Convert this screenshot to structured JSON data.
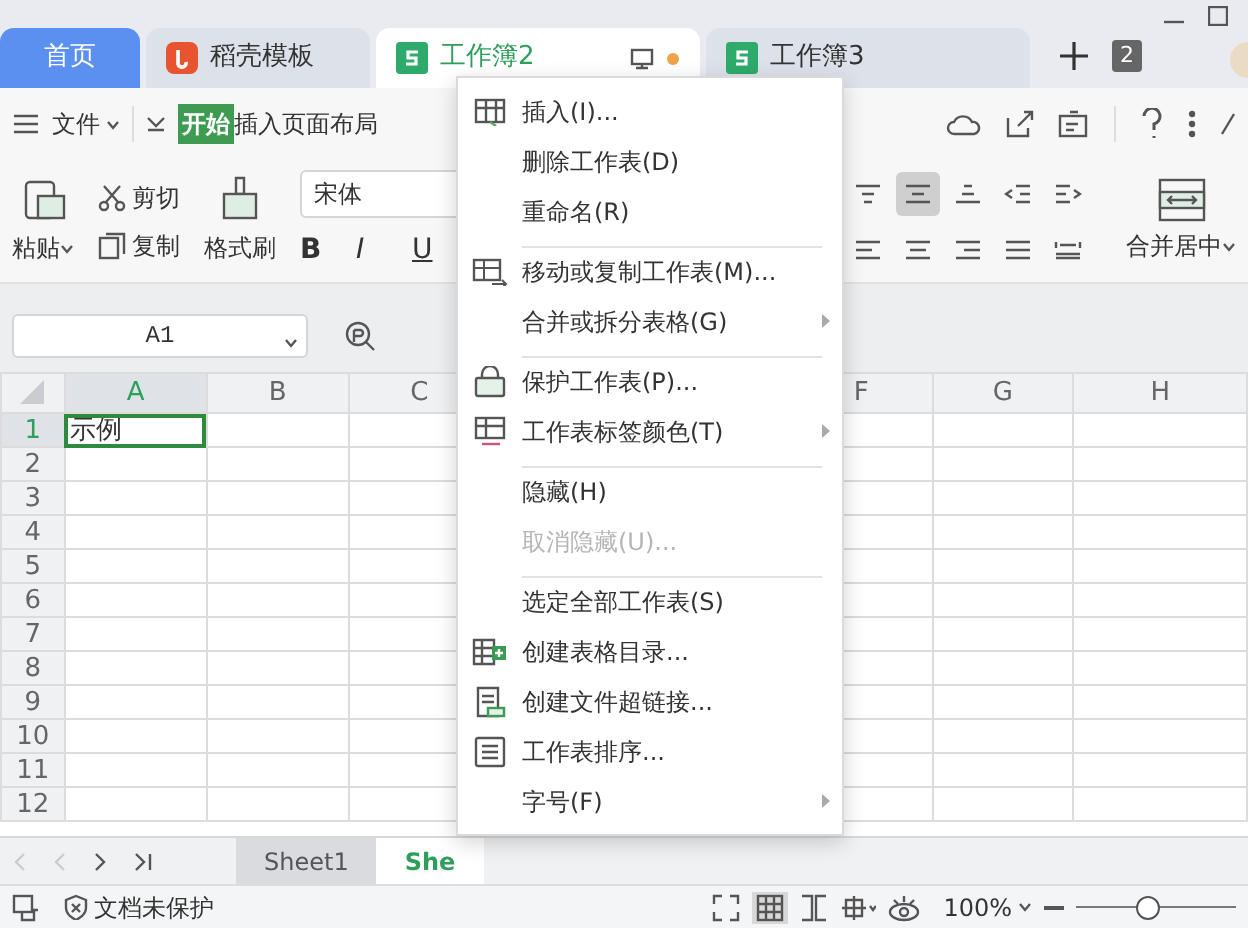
{
  "tabs": [
    {
      "label": "首页",
      "kind": "home",
      "selected": false,
      "unsaved": false
    },
    {
      "label": "稻壳模板",
      "kind": "docer",
      "selected": false,
      "unsaved": false
    },
    {
      "label": "工作簿2",
      "kind": "sheet",
      "selected": true,
      "unsaved": true
    },
    {
      "label": "工作簿3",
      "kind": "sheet",
      "selected": false,
      "unsaved": false
    }
  ],
  "window_count": "2",
  "menu_bar": {
    "file": "文件",
    "items": [
      {
        "label": "开始",
        "selected": true
      },
      {
        "label": "插入",
        "selected": false
      },
      {
        "label": "页面布局",
        "selected": false
      }
    ]
  },
  "ribbon": {
    "paste": "粘贴",
    "cut": "剪切",
    "copy": "复制",
    "format_painter": "格式刷",
    "font": "宋体",
    "styles": [
      "B",
      "I",
      "U"
    ],
    "merge": "合并居中",
    "align_buttons": [
      {
        "kind": "top",
        "selected": false
      },
      {
        "kind": "middle",
        "selected": true
      },
      {
        "kind": "bottom",
        "selected": false
      },
      {
        "kind": "outdent",
        "selected": false
      },
      {
        "kind": "indent",
        "selected": false
      },
      {
        "kind": "left",
        "selected": false
      },
      {
        "kind": "center",
        "selected": false
      },
      {
        "kind": "right",
        "selected": false
      },
      {
        "kind": "justify",
        "selected": false
      },
      {
        "kind": "distribute",
        "selected": false
      }
    ]
  },
  "formula_bar": {
    "name_box": "A1"
  },
  "sheet": {
    "columns": [
      {
        "label": "A",
        "selected": true
      },
      {
        "label": "B",
        "selected": false
      },
      {
        "label": "C",
        "selected": false
      },
      {
        "label": "F",
        "selected": false
      },
      {
        "label": "G",
        "selected": false
      },
      {
        "label": "H",
        "selected": false
      }
    ],
    "rows": [
      {
        "label": "1",
        "selected": true,
        "cells": [
          "示例"
        ]
      },
      {
        "label": "2",
        "selected": false
      },
      {
        "label": "3",
        "selected": false
      },
      {
        "label": "4",
        "selected": false
      },
      {
        "label": "5",
        "selected": false
      },
      {
        "label": "6",
        "selected": false
      },
      {
        "label": "7",
        "selected": false
      },
      {
        "label": "8",
        "selected": false
      },
      {
        "label": "9",
        "selected": false
      },
      {
        "label": "10",
        "selected": false
      },
      {
        "label": "11",
        "selected": false
      },
      {
        "label": "12",
        "selected": false
      }
    ]
  },
  "sheet_tabs": [
    {
      "label": "Sheet1",
      "selected": false
    },
    {
      "label": "She",
      "selected": true
    }
  ],
  "status_bar": {
    "protection": "文档未保护",
    "zoom": "100%",
    "zoom_slider": {
      "level": 0.45
    }
  },
  "context_menu": [
    {
      "label": "插入(I)...",
      "kind": "grid",
      "separator": false,
      "submenu": false,
      "disabled": false
    },
    {
      "label": "删除工作表(D)",
      "kind": "plain",
      "separator": false,
      "submenu": false,
      "disabled": false
    },
    {
      "label": "重命名(R)",
      "kind": "plain",
      "separator": false,
      "submenu": false,
      "disabled": false
    },
    {
      "label": "移动或复制工作表(M)...",
      "kind": "move",
      "separator": true,
      "submenu": false,
      "disabled": false
    },
    {
      "label": "合并或拆分表格(G)",
      "kind": "plain",
      "separator": false,
      "submenu": true,
      "disabled": false
    },
    {
      "label": "保护工作表(P)...",
      "kind": "lock",
      "separator": true,
      "submenu": false,
      "disabled": false
    },
    {
      "label": "工作表标签颜色(T)",
      "kind": "tabcolor",
      "separator": false,
      "submenu": true,
      "disabled": false
    },
    {
      "label": "隐藏(H)",
      "kind": "plain",
      "separator": true,
      "submenu": false,
      "disabled": false
    },
    {
      "label": "取消隐藏(U)...",
      "kind": "plain",
      "separator": false,
      "submenu": false,
      "disabled": true
    },
    {
      "label": "选定全部工作表(S)",
      "kind": "plain",
      "separator": true,
      "submenu": false,
      "disabled": false
    },
    {
      "label": "创建表格目录...",
      "kind": "addgrid",
      "separator": false,
      "submenu": false,
      "disabled": false
    },
    {
      "label": "创建文件超链接...",
      "kind": "link",
      "separator": false,
      "submenu": false,
      "disabled": false
    },
    {
      "label": "工作表排序...",
      "kind": "list",
      "separator": false,
      "submenu": false,
      "disabled": false
    },
    {
      "label": "字号(F)",
      "kind": "plain",
      "separator": false,
      "submenu": true,
      "disabled": false
    }
  ]
}
